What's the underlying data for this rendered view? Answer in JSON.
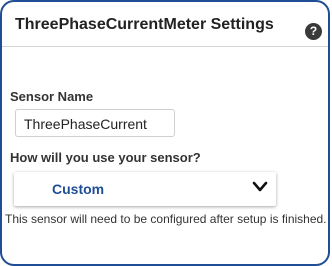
{
  "dialog": {
    "title": "ThreePhaseCurrentMeter Settings",
    "help_icon": "question-mark-icon",
    "help_glyph": "?"
  },
  "form": {
    "sensor_name_label": "Sensor Name",
    "sensor_name_value": "ThreePhaseCurrent",
    "usage_label": "How will you use your sensor?",
    "usage_selected": "Custom",
    "dropdown_icon": "chevron-down-icon",
    "note": "This sensor will need to be configured after setup is finished."
  },
  "colors": {
    "accent": "#1f4e96",
    "text": "#333333",
    "border": "#cfcfcf"
  }
}
